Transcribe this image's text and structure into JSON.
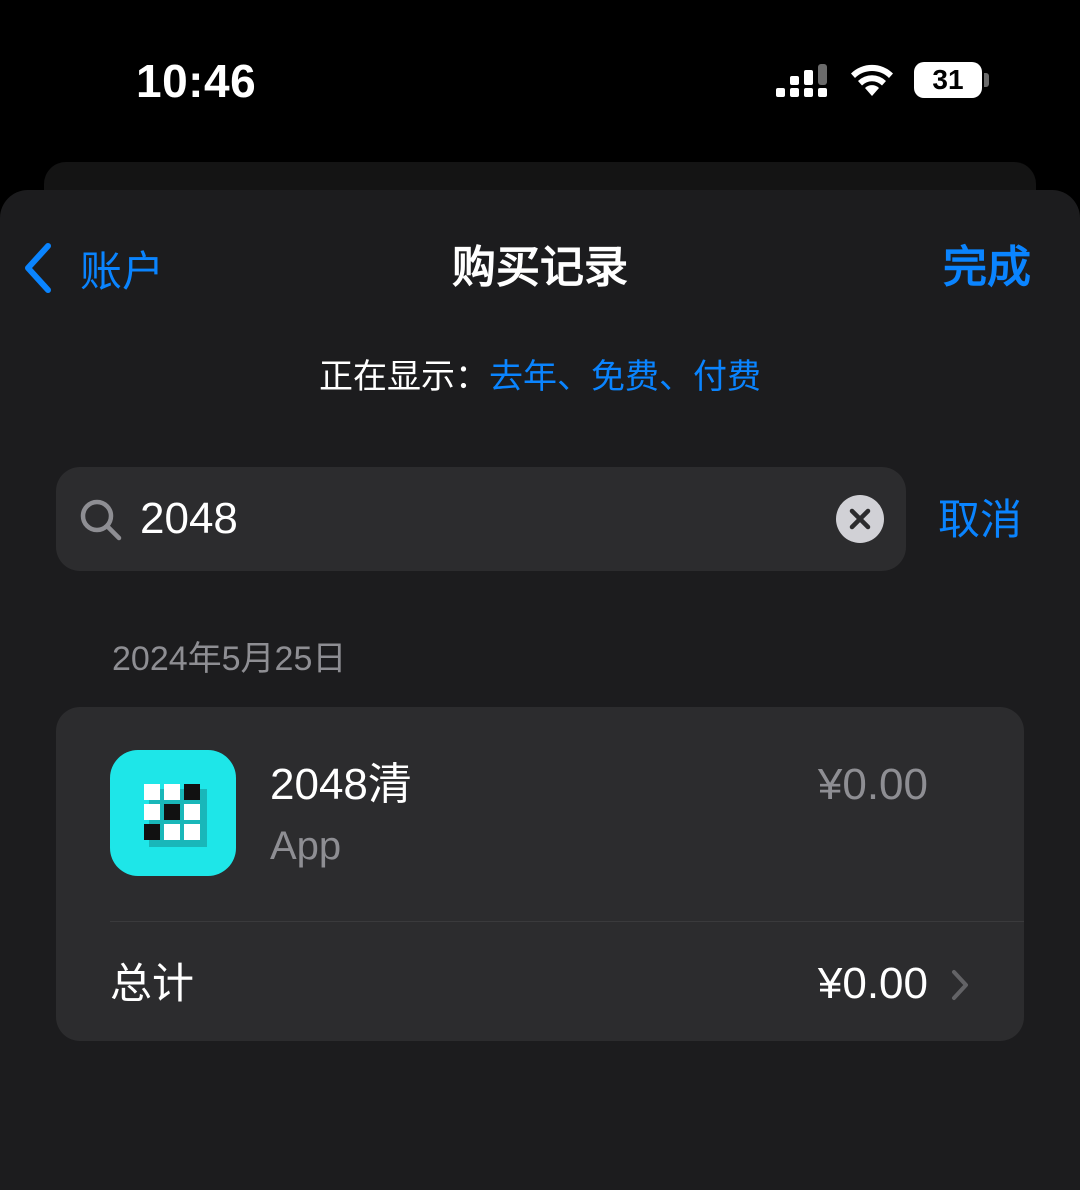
{
  "status_bar": {
    "time": "10:46",
    "battery_level": "31",
    "icons": [
      "signal-icon",
      "wifi-icon",
      "battery-icon"
    ]
  },
  "nav": {
    "back_label": "账户",
    "title": "购买记录",
    "done_label": "完成"
  },
  "filter": {
    "prefix": "正在显示：",
    "value": "去年、免费、付费"
  },
  "search": {
    "value": "2048",
    "cancel_label": "取消"
  },
  "section": {
    "date": "2024年5月25日"
  },
  "purchases": [
    {
      "name": "2048清",
      "type": "App",
      "price": "¥0.00"
    }
  ],
  "total": {
    "label": "总计",
    "amount": "¥0.00"
  },
  "colors": {
    "accent": "#0a84ff",
    "background": "#1c1c1e",
    "card": "#2c2c2e",
    "secondary_text": "#8e8e93",
    "app_icon": "#1ee6e8"
  }
}
